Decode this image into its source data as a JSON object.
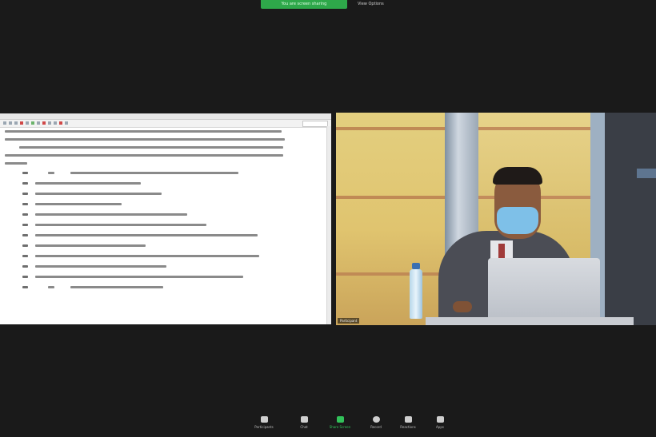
{
  "top": {
    "share_banner": "You are screen sharing",
    "view_options": "View Options"
  },
  "video": {
    "participant_name": "Participant"
  },
  "toolbar": {
    "buttons": [
      {
        "label": "Participants",
        "icon": "participants-icon"
      },
      {
        "label": "Chat",
        "icon": "chat-icon"
      },
      {
        "label": "Share Screen",
        "icon": "share-screen-icon"
      },
      {
        "label": "Record",
        "icon": "record-icon"
      },
      {
        "label": "Reactions",
        "icon": "reactions-icon"
      },
      {
        "label": "Apps",
        "icon": "apps-icon"
      }
    ]
  },
  "colors": {
    "background": "#1a1a1a",
    "share_green": "#2ea84a"
  }
}
